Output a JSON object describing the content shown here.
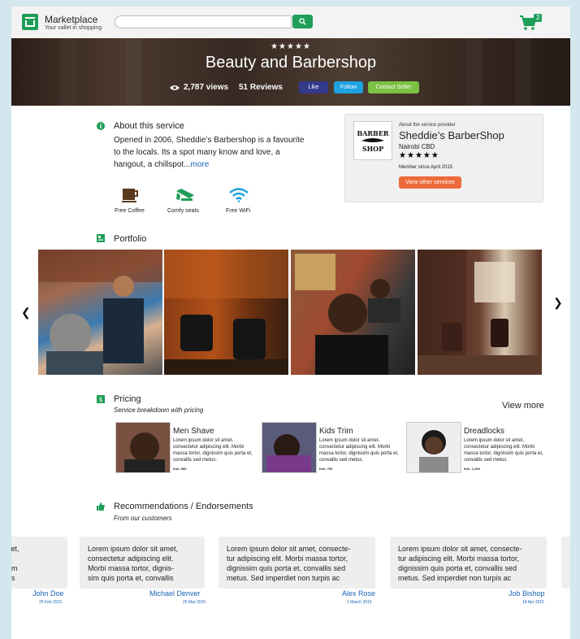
{
  "header": {
    "brand": "Marketplace",
    "tagline": "Your vallet in shopping",
    "search_placeholder": "",
    "cart_count": "2",
    "accent": "#1e9e58"
  },
  "hero": {
    "rating": 5,
    "title": "Beauty and Barbershop",
    "views": "2,787 views",
    "reviews": "51 Reviews",
    "like_label": "Like",
    "follow_label": "Follow",
    "contact_label": "Contact Seller"
  },
  "about": {
    "title": "About this service",
    "text": "Opened in 2006, Sheddie’s Barbershop is a favourite to the locals. Its a spot many know and love, a hangout, a chillspot...",
    "more_label": "more",
    "amenities": [
      {
        "icon": "coffee-icon",
        "label": "Free Coffee"
      },
      {
        "icon": "seat-icon",
        "label": "Comfy seats"
      },
      {
        "icon": "wifi-icon",
        "label": "Free WiFi"
      }
    ]
  },
  "provider": {
    "about_label": "About the service provider",
    "name": "Sheddie’s BarberShop",
    "location": "Nairobi CBD",
    "rating": 5,
    "member_since": "Member since April 2015",
    "button_label": "View other services",
    "logo_text_top": "BARBER",
    "logo_text_bottom": "SHOP"
  },
  "portfolio": {
    "title": "Portfolio"
  },
  "pricing": {
    "title": "Pricing",
    "subtitle": "Service breakdown with pricing",
    "view_more": "View more",
    "items": [
      {
        "name": "Men Shave",
        "desc": "Lorem ipsum dolor sit amet, consectetur adipiscing elit. Morbi massa tortor, dignissim quis porta et, convallis sed metus.",
        "price": "Ksh. 500"
      },
      {
        "name": "Kids Trim",
        "desc": "Lorem ipsum dolor sit amet, consectetur adipiscing elit. Morbi massa tortor, dignissim quis porta et, convallis sed metus.",
        "price": "Ksh. 700"
      },
      {
        "name": "Dreadlocks",
        "desc": "Lorem ipsum dolor sit amet, consectetur adipiscing elit. Morbi massa tortor, dignissim quis porta et, convallis sed metus.",
        "price": "Ksh. 1,200"
      }
    ]
  },
  "recommendations": {
    "title": "Recommendations / Endorsements",
    "subtitle": "From our customers",
    "items": [
      {
        "text": "or sit amet,\nelit.\n, dignissim\n, convallis",
        "name": "John Doe",
        "date": "26 Feb 2015"
      },
      {
        "text": "Lorem ipsum dolor sit amet,\nconsectetur adipiscing elit.\nMorbi massa tortor, dignis-\nsim quis porta et, convallis",
        "name": "Michael Denver",
        "date": "26 Mar 2015"
      },
      {
        "text": "Lorem ipsum dolor sit amet, consecte-\ntur adipiscing elit. Morbi massa tortor,\ndignissim quis porta et, convallis sed\nmetus. Sed imperdiet non turpis ac",
        "name": "Alex Rose",
        "date": "1 March  2015"
      },
      {
        "text": "Lorem ipsum dolor sit amet, consecte-\ntur adipiscing elit. Morbi massa tortor,\ndignissim quis porta et, convallis sed\nmetus. Sed imperdiet non turpis ac",
        "name": "Job Bishop",
        "date": "18 Apr 2015"
      }
    ]
  }
}
